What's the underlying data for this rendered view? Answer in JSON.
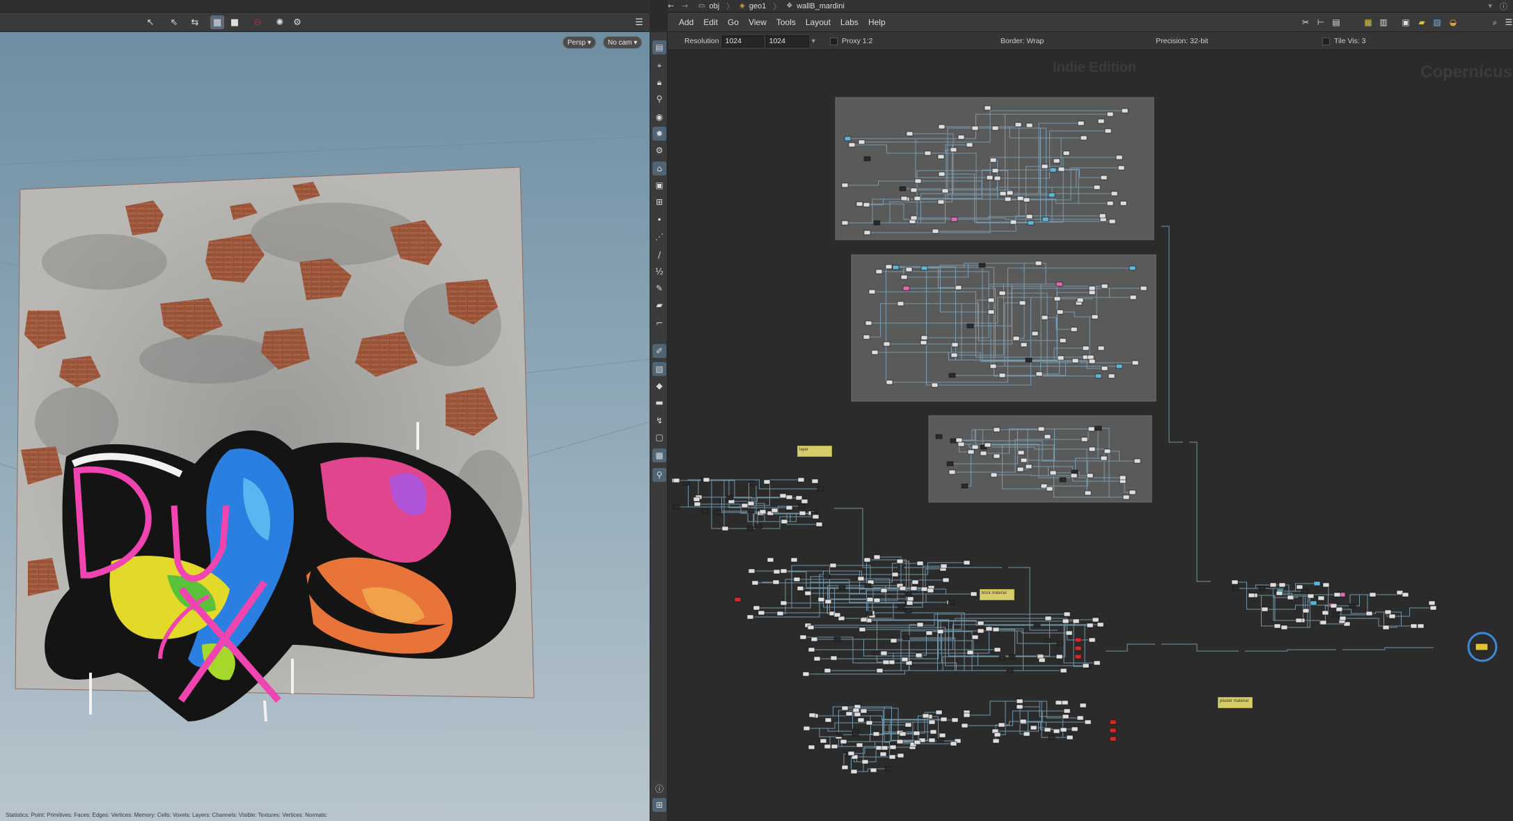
{
  "viewport": {
    "toolbar_icons": [
      "select-icon",
      "transform-icon",
      "snap-icon",
      "display-mode-icon",
      "camera-mode-icon",
      "disabled-icon",
      "light-icon",
      "settings-icon"
    ],
    "camera_menu": "Persp",
    "cam_select": "No cam",
    "status_text": "Statistics: Point: Primitives: Faces: Edges: Vertices: Memory: Cells: Voxels: Layers: Channels: Visible: Textures: Vertices: Normals:"
  },
  "shelf": {
    "icons": [
      "viewport-layout-icon",
      "handle-icon",
      "lock-icon",
      "pin-icon",
      "ghost-icon",
      "lighting-icon",
      "camera-icon",
      "home-icon",
      "frame-icon",
      "grid-icon",
      "visualizer-icon",
      "point-icon",
      "edge-icon",
      "measure-icon",
      "sculpt-icon",
      "wire-icon",
      "ruler-icon",
      "snapshot-icon",
      "background-icon",
      "tool-icon",
      "group-icon",
      "selection-icon",
      "hide-icon",
      "info-icon",
      "display-options-icon"
    ]
  },
  "network": {
    "path": [
      "obj",
      "geo1",
      "wallB_mardini"
    ],
    "menu": [
      "Add",
      "Edit",
      "Go",
      "View",
      "Tools",
      "Layout",
      "Labs",
      "Help"
    ],
    "params": {
      "resolution_label": "Resolution",
      "res_x": "1024",
      "res_y": "1024",
      "proxy_label": "Proxy 1:2",
      "border_label": "Border: Wrap",
      "precision_label": "Precision: 32-bit",
      "tilevis_label": "Tile Vis: 3"
    },
    "watermark_edition": "Indie Edition",
    "watermark_context": "Copernicus",
    "sticky_notes": [
      "layer",
      "brick material",
      "plaster material"
    ]
  },
  "colors": {
    "accent": "#5a6a7a",
    "sticky": "#d6cd6a",
    "net_box": "#5a5a5a",
    "wire": "#7ea7bf",
    "error_node": "#d22a2a"
  }
}
